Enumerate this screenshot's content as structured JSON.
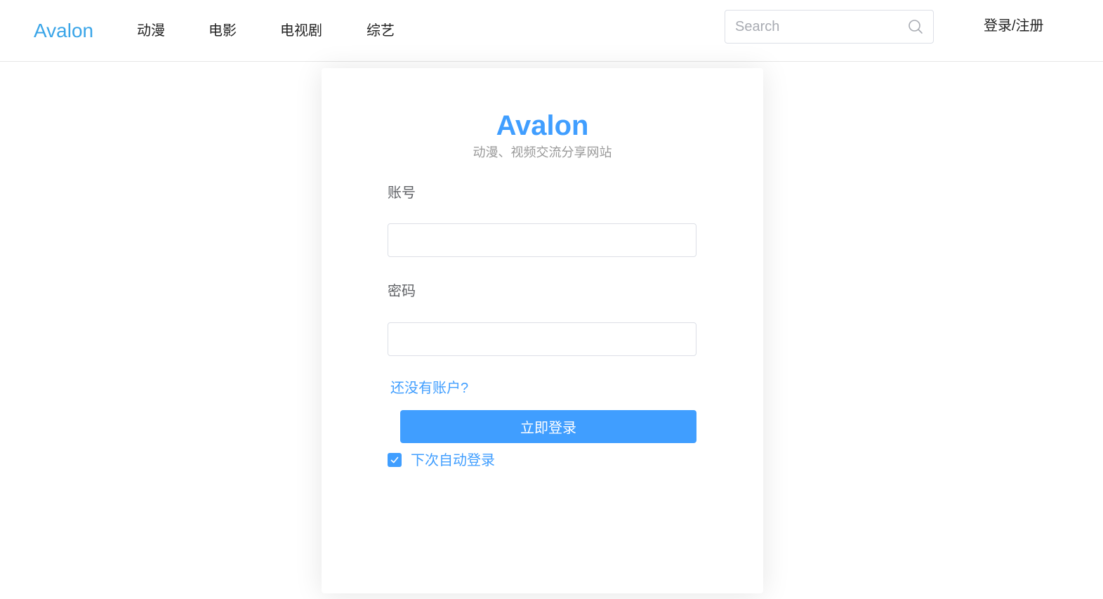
{
  "header": {
    "brand": "Avalon",
    "nav": [
      {
        "label": "动漫"
      },
      {
        "label": "电影"
      },
      {
        "label": "电视剧"
      },
      {
        "label": "综艺"
      }
    ],
    "search": {
      "placeholder": "Search",
      "value": "",
      "icon": "search-icon"
    },
    "login_label": "登录/注册"
  },
  "login_card": {
    "title": "Avalon",
    "subtitle": "动漫、视频交流分享网站",
    "account_label": "账号",
    "account_value": "",
    "password_label": "密码",
    "password_value": "",
    "register_link": "还没有账户?",
    "submit_label": "立即登录",
    "remember": {
      "label": "下次自动登录",
      "checked": true
    }
  },
  "colors": {
    "brand": "#3aa5e8",
    "primary": "#409eff",
    "text": "#222222",
    "muted": "#999999"
  }
}
